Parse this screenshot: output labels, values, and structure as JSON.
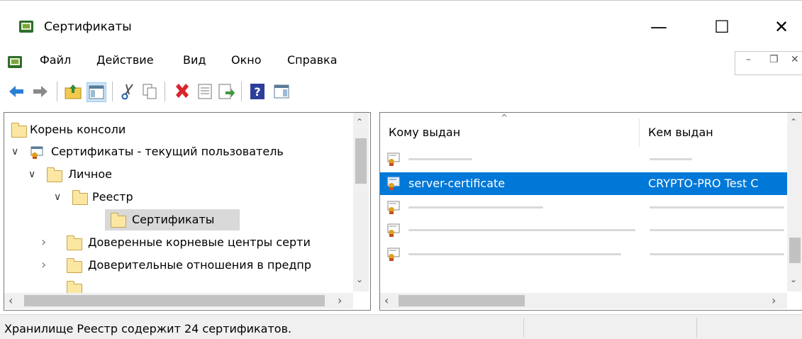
{
  "window": {
    "title": "Сертификаты",
    "minimize": "—",
    "maximize": "☐",
    "close": "✕"
  },
  "menu": [
    "Файл",
    "Действие",
    "Вид",
    "Окно",
    "Справка"
  ],
  "mdi": {
    "minimize": "–",
    "restore": "❐",
    "close": "✕"
  },
  "toolbar": {
    "icons": [
      "back-icon",
      "forward-icon",
      "up-folder-icon",
      "show-hide-tree-icon",
      "cut-icon",
      "copy-icon",
      "delete-icon",
      "properties-icon",
      "export-icon",
      "help-icon",
      "action-pane-icon"
    ]
  },
  "tree": [
    {
      "label": "Корень консоли",
      "level": 0,
      "expand": ""
    },
    {
      "label": "Сертификаты - текущий пользователь",
      "level": 1,
      "expand": "∨"
    },
    {
      "label": "Личное",
      "level": 2,
      "expand": "∨"
    },
    {
      "label": "Реестр",
      "level": 3,
      "expand": "∨"
    },
    {
      "label": "Сертификаты",
      "level": 4,
      "expand": "",
      "selected": true
    },
    {
      "label": "Доверенные корневые центры серти",
      "level": 2,
      "expand": "›"
    },
    {
      "label": "Доверительные отношения в предпр",
      "level": 2,
      "expand": "›"
    }
  ],
  "list": {
    "columns": [
      "Кому выдан",
      "Кем выдан"
    ],
    "rows": [
      {
        "issued_to": "",
        "issued_by": "",
        "selected": false
      },
      {
        "issued_to": "server-certificate",
        "issued_by": "CRYPTO-PRO Test C",
        "selected": true
      },
      {
        "issued_to": "",
        "issued_by": "",
        "selected": false
      },
      {
        "issued_to": "",
        "issued_by": "",
        "selected": false
      },
      {
        "issued_to": "",
        "issued_by": "",
        "selected": false
      }
    ]
  },
  "status": {
    "text": "Хранилище Реестр содержит 24 сертификатов."
  },
  "colors": {
    "selection": "#0078d7",
    "folder": "#fbe7a1",
    "back_arrow": "#2a7fd4"
  }
}
